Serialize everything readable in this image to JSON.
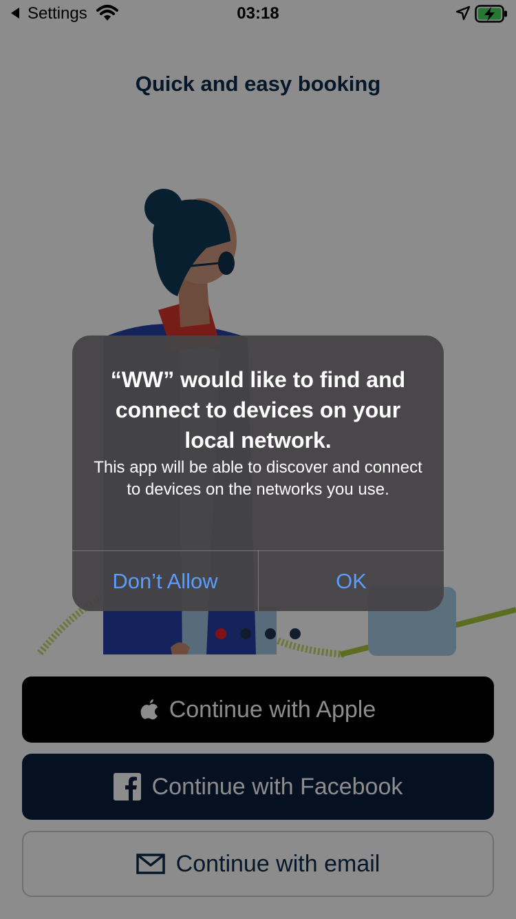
{
  "status_bar": {
    "back_app": "Settings",
    "time": "03:18",
    "icons": [
      "back-arrow-icon",
      "wifi-icon",
      "location-arrow-icon",
      "battery-charging-icon"
    ]
  },
  "onboarding": {
    "title": "Quick and easy booking",
    "pagination": {
      "count": 4,
      "active_index": 0,
      "active_color": "#e8202a",
      "inactive_color": "#1f3550"
    }
  },
  "auth_buttons": {
    "apple": {
      "label": "Continue with Apple",
      "icon": "apple-icon"
    },
    "facebook": {
      "label": "Continue with Facebook",
      "icon": "facebook-icon"
    },
    "email": {
      "label": "Continue with email",
      "icon": "envelope-icon"
    }
  },
  "alert": {
    "title": "“WW” would like to find and connect to devices on your local network.",
    "message": "This app will be able to discover and connect to devices on the networks you use.",
    "deny_label": "Don’t Allow",
    "ok_label": "OK"
  },
  "colors": {
    "brand_navy": "#0a2a4a",
    "facebook_bg": "#0a1f3d",
    "alert_button_blue": "#5b9cff"
  }
}
